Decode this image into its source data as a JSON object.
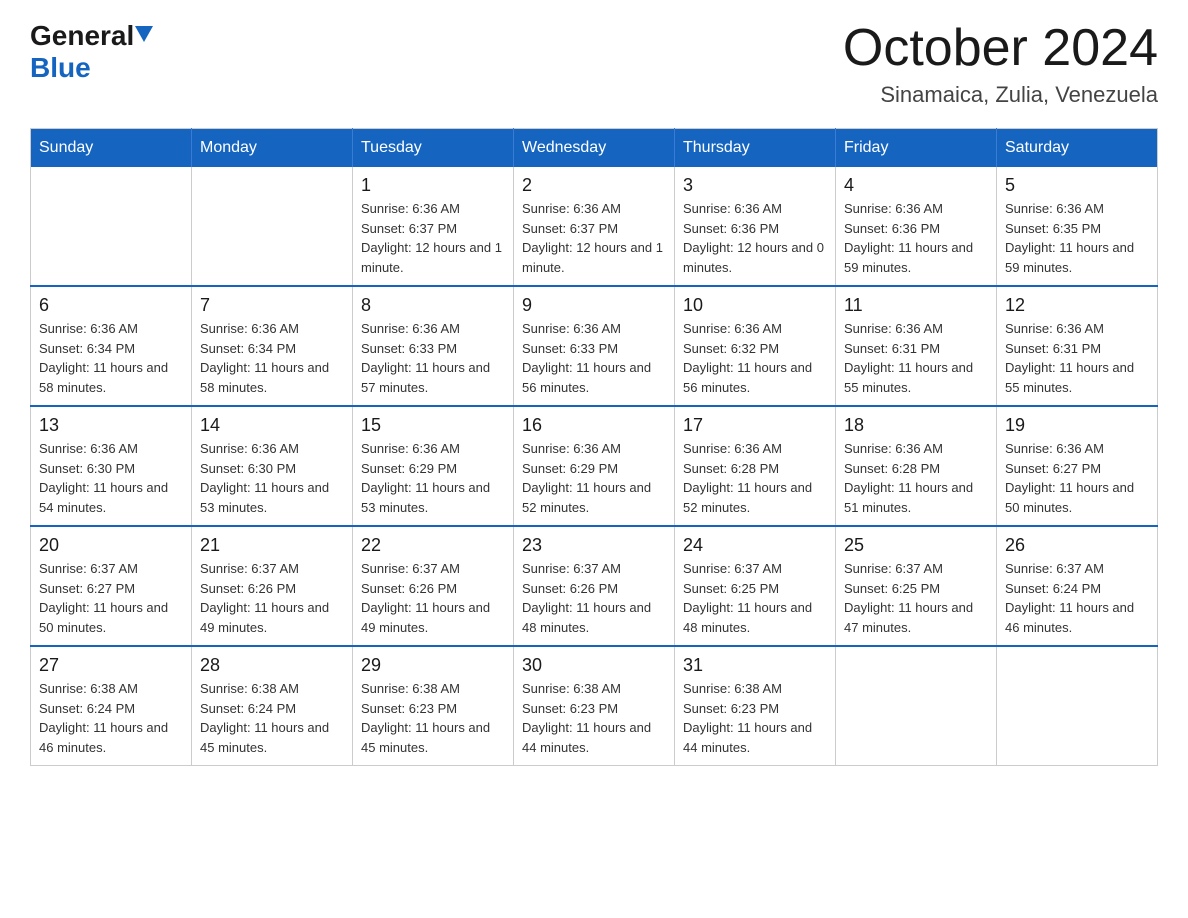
{
  "header": {
    "logo": {
      "general": "General",
      "blue": "Blue",
      "arrow_alt": "arrow down"
    },
    "title": "October 2024",
    "subtitle": "Sinamaica, Zulia, Venezuela"
  },
  "calendar": {
    "days_of_week": [
      "Sunday",
      "Monday",
      "Tuesday",
      "Wednesday",
      "Thursday",
      "Friday",
      "Saturday"
    ],
    "weeks": [
      [
        {
          "day": "",
          "info": ""
        },
        {
          "day": "",
          "info": ""
        },
        {
          "day": "1",
          "info": "Sunrise: 6:36 AM\nSunset: 6:37 PM\nDaylight: 12 hours and 1 minute."
        },
        {
          "day": "2",
          "info": "Sunrise: 6:36 AM\nSunset: 6:37 PM\nDaylight: 12 hours and 1 minute."
        },
        {
          "day": "3",
          "info": "Sunrise: 6:36 AM\nSunset: 6:36 PM\nDaylight: 12 hours and 0 minutes."
        },
        {
          "day": "4",
          "info": "Sunrise: 6:36 AM\nSunset: 6:36 PM\nDaylight: 11 hours and 59 minutes."
        },
        {
          "day": "5",
          "info": "Sunrise: 6:36 AM\nSunset: 6:35 PM\nDaylight: 11 hours and 59 minutes."
        }
      ],
      [
        {
          "day": "6",
          "info": "Sunrise: 6:36 AM\nSunset: 6:34 PM\nDaylight: 11 hours and 58 minutes."
        },
        {
          "day": "7",
          "info": "Sunrise: 6:36 AM\nSunset: 6:34 PM\nDaylight: 11 hours and 58 minutes."
        },
        {
          "day": "8",
          "info": "Sunrise: 6:36 AM\nSunset: 6:33 PM\nDaylight: 11 hours and 57 minutes."
        },
        {
          "day": "9",
          "info": "Sunrise: 6:36 AM\nSunset: 6:33 PM\nDaylight: 11 hours and 56 minutes."
        },
        {
          "day": "10",
          "info": "Sunrise: 6:36 AM\nSunset: 6:32 PM\nDaylight: 11 hours and 56 minutes."
        },
        {
          "day": "11",
          "info": "Sunrise: 6:36 AM\nSunset: 6:31 PM\nDaylight: 11 hours and 55 minutes."
        },
        {
          "day": "12",
          "info": "Sunrise: 6:36 AM\nSunset: 6:31 PM\nDaylight: 11 hours and 55 minutes."
        }
      ],
      [
        {
          "day": "13",
          "info": "Sunrise: 6:36 AM\nSunset: 6:30 PM\nDaylight: 11 hours and 54 minutes."
        },
        {
          "day": "14",
          "info": "Sunrise: 6:36 AM\nSunset: 6:30 PM\nDaylight: 11 hours and 53 minutes."
        },
        {
          "day": "15",
          "info": "Sunrise: 6:36 AM\nSunset: 6:29 PM\nDaylight: 11 hours and 53 minutes."
        },
        {
          "day": "16",
          "info": "Sunrise: 6:36 AM\nSunset: 6:29 PM\nDaylight: 11 hours and 52 minutes."
        },
        {
          "day": "17",
          "info": "Sunrise: 6:36 AM\nSunset: 6:28 PM\nDaylight: 11 hours and 52 minutes."
        },
        {
          "day": "18",
          "info": "Sunrise: 6:36 AM\nSunset: 6:28 PM\nDaylight: 11 hours and 51 minutes."
        },
        {
          "day": "19",
          "info": "Sunrise: 6:36 AM\nSunset: 6:27 PM\nDaylight: 11 hours and 50 minutes."
        }
      ],
      [
        {
          "day": "20",
          "info": "Sunrise: 6:37 AM\nSunset: 6:27 PM\nDaylight: 11 hours and 50 minutes."
        },
        {
          "day": "21",
          "info": "Sunrise: 6:37 AM\nSunset: 6:26 PM\nDaylight: 11 hours and 49 minutes."
        },
        {
          "day": "22",
          "info": "Sunrise: 6:37 AM\nSunset: 6:26 PM\nDaylight: 11 hours and 49 minutes."
        },
        {
          "day": "23",
          "info": "Sunrise: 6:37 AM\nSunset: 6:26 PM\nDaylight: 11 hours and 48 minutes."
        },
        {
          "day": "24",
          "info": "Sunrise: 6:37 AM\nSunset: 6:25 PM\nDaylight: 11 hours and 48 minutes."
        },
        {
          "day": "25",
          "info": "Sunrise: 6:37 AM\nSunset: 6:25 PM\nDaylight: 11 hours and 47 minutes."
        },
        {
          "day": "26",
          "info": "Sunrise: 6:37 AM\nSunset: 6:24 PM\nDaylight: 11 hours and 46 minutes."
        }
      ],
      [
        {
          "day": "27",
          "info": "Sunrise: 6:38 AM\nSunset: 6:24 PM\nDaylight: 11 hours and 46 minutes."
        },
        {
          "day": "28",
          "info": "Sunrise: 6:38 AM\nSunset: 6:24 PM\nDaylight: 11 hours and 45 minutes."
        },
        {
          "day": "29",
          "info": "Sunrise: 6:38 AM\nSunset: 6:23 PM\nDaylight: 11 hours and 45 minutes."
        },
        {
          "day": "30",
          "info": "Sunrise: 6:38 AM\nSunset: 6:23 PM\nDaylight: 11 hours and 44 minutes."
        },
        {
          "day": "31",
          "info": "Sunrise: 6:38 AM\nSunset: 6:23 PM\nDaylight: 11 hours and 44 minutes."
        },
        {
          "day": "",
          "info": ""
        },
        {
          "day": "",
          "info": ""
        }
      ]
    ]
  }
}
